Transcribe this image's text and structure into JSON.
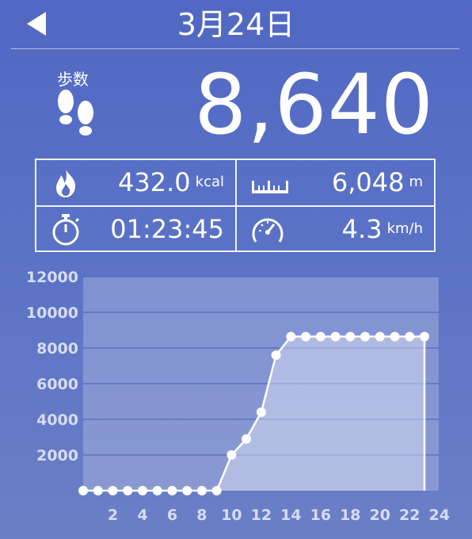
{
  "header": {
    "title": "3月24日",
    "back_icon": "back-arrow-icon"
  },
  "steps": {
    "label": "歩数",
    "value": "8,640",
    "icon": "footprints-icon"
  },
  "stats": {
    "calories": {
      "value": "432.0",
      "unit": "kcal",
      "icon": "flame-icon"
    },
    "distance": {
      "value": "6,048",
      "unit": "m",
      "icon": "ruler-icon"
    },
    "time": {
      "value": "01:23:45",
      "icon": "stopwatch-icon"
    },
    "speed": {
      "value": "4.3",
      "unit": "km/h",
      "icon": "speedometer-icon"
    }
  },
  "chart_data": {
    "type": "area",
    "x": [
      0,
      1,
      2,
      3,
      4,
      5,
      6,
      7,
      8,
      9,
      10,
      11,
      12,
      13,
      14,
      15,
      16,
      17,
      18,
      19,
      20,
      21,
      22,
      23
    ],
    "values": [
      0,
      0,
      0,
      0,
      0,
      0,
      0,
      0,
      0,
      0,
      2000,
      2900,
      4400,
      7600,
      8640,
      8640,
      8640,
      8640,
      8640,
      8640,
      8640,
      8640,
      8640,
      8640
    ],
    "xticks": [
      "2",
      "4",
      "6",
      "8",
      "10",
      "12",
      "14",
      "16",
      "18",
      "20",
      "22",
      "24"
    ],
    "yticks": [
      "2000",
      "4000",
      "6000",
      "8000",
      "10000",
      "12000"
    ],
    "xlim": [
      0,
      24
    ],
    "ylim": [
      0,
      12000
    ],
    "grid": true
  }
}
